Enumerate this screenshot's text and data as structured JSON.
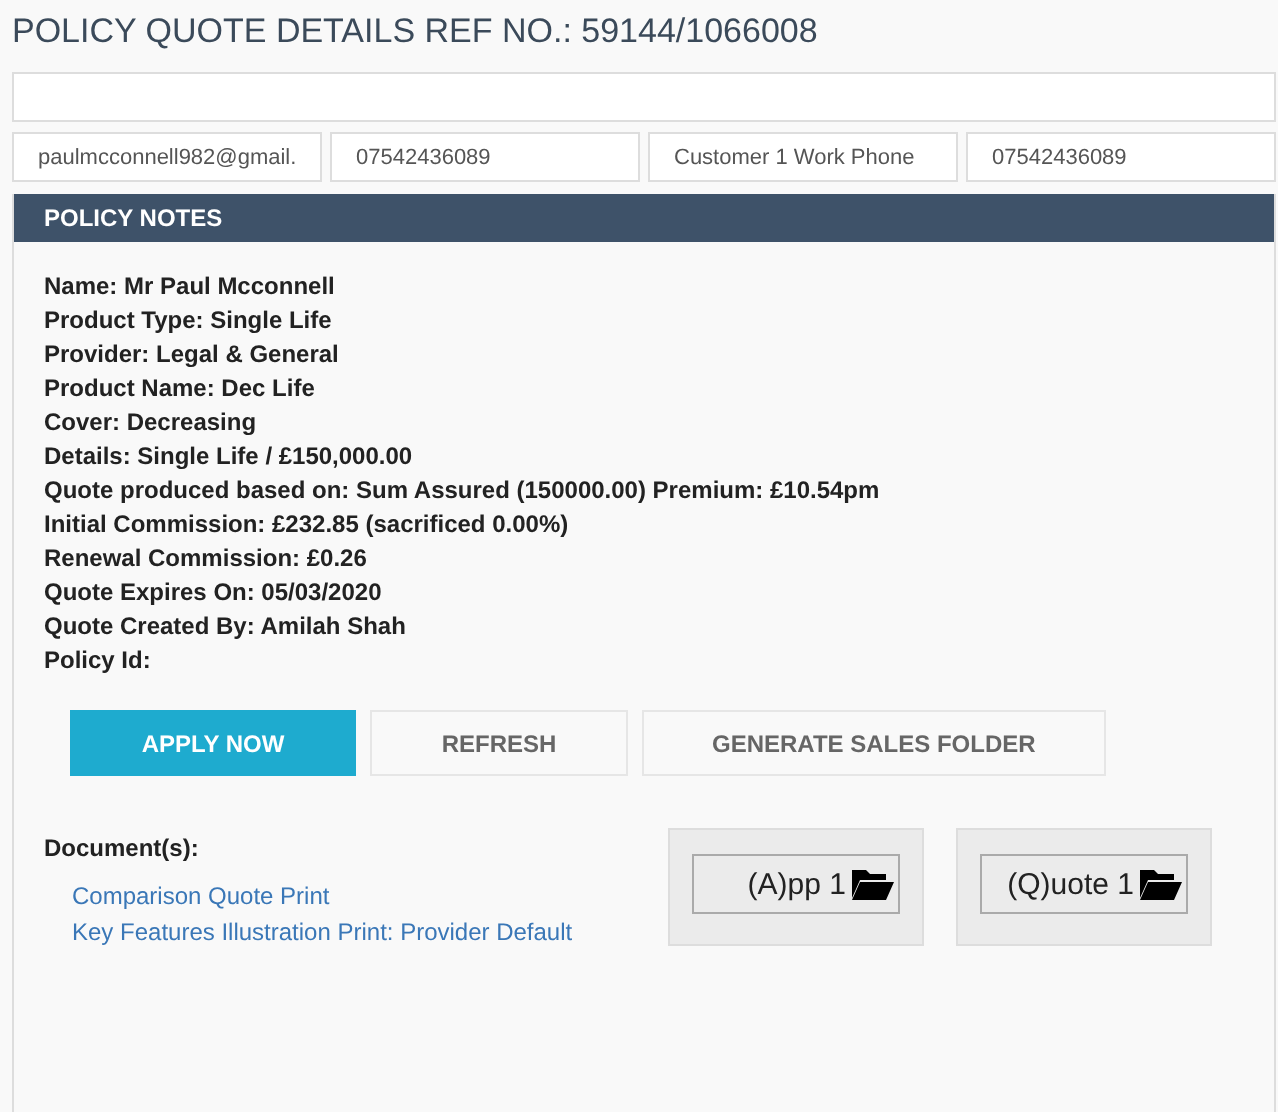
{
  "title": "POLICY QUOTE DETAILS REF NO.: 59144/1066008",
  "contact_fields": [
    {
      "value": "paulmcconnell982@gmail."
    },
    {
      "value": "07542436089"
    },
    {
      "value": "Customer 1 Work Phone"
    },
    {
      "value": "07542436089"
    }
  ],
  "panel": {
    "title": "POLICY NOTES",
    "notes": [
      "Name: Mr Paul Mcconnell",
      "Product Type: Single Life",
      "Provider: Legal & General",
      "Product Name: Dec Life",
      "Cover: Decreasing",
      "Details: Single Life / £150,000.00",
      "Quote produced based on: Sum Assured (150000.00) Premium: £10.54pm",
      "Initial Commission: £232.85 (sacrificed 0.00%)",
      "Renewal Commission: £0.26",
      "Quote Expires On: 05/03/2020",
      "Quote Created By: Amilah Shah",
      "Policy Id:"
    ],
    "buttons": [
      {
        "label": "APPLY NOW",
        "kind": "primary"
      },
      {
        "label": "REFRESH",
        "kind": "secondary"
      },
      {
        "label": "GENERATE SALES FOLDER",
        "kind": "secondary"
      }
    ],
    "documents_label": "Document(s):",
    "documents": [
      "Comparison Quote Print",
      "Key Features Illustration Print: Provider Default"
    ],
    "doc_buttons": [
      {
        "label": "(A)pp 1"
      },
      {
        "label": "(Q)uote 1"
      }
    ]
  }
}
